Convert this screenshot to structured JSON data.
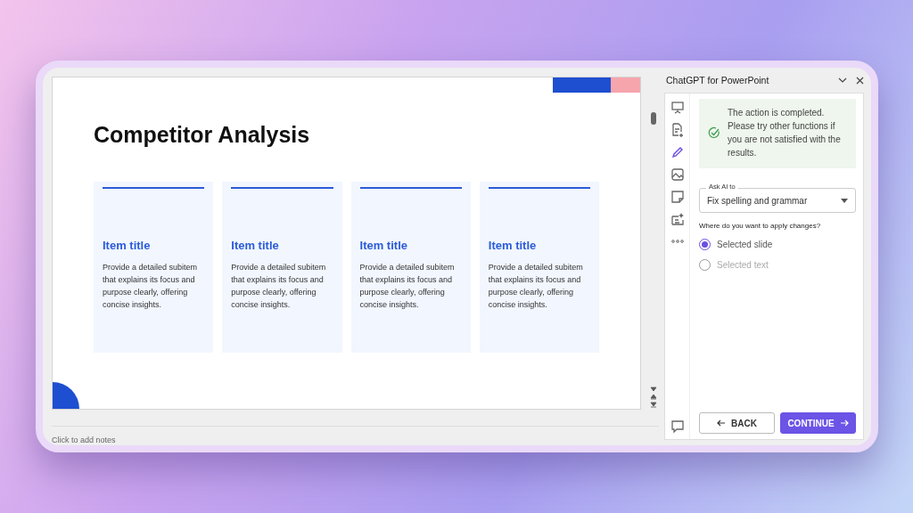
{
  "slide": {
    "title": "Competitor Analysis",
    "cards": [
      {
        "title": "Item title",
        "body": "Provide a detailed subitem that explains its focus and purpose clearly, offering concise insights."
      },
      {
        "title": "Item title",
        "body": "Provide a detailed subitem that explains its focus and purpose clearly, offering concise insights."
      },
      {
        "title": "Item title",
        "body": "Provide a detailed subitem that explains its focus and purpose clearly, offering concise insights."
      },
      {
        "title": "Item title",
        "body": "Provide a detailed subitem that explains its focus and purpose clearly, offering concise insights."
      }
    ]
  },
  "notes": {
    "placeholder": "Click to add notes"
  },
  "panel": {
    "title": "ChatGPT for PowerPoint",
    "tools": [
      {
        "kind": "slide",
        "selected": false
      },
      {
        "kind": "document",
        "selected": false
      },
      {
        "kind": "pencil",
        "selected": true
      },
      {
        "kind": "image",
        "selected": false
      },
      {
        "kind": "note",
        "selected": false
      },
      {
        "kind": "sparkle",
        "selected": false
      },
      {
        "kind": "more",
        "selected": false
      }
    ],
    "toast": "The action is completed. Please try other functions if you are not satisfied with the results.",
    "ask": {
      "label": "Ask AI to",
      "value": "Fix spelling and grammar"
    },
    "question": "Where do you want to apply changes?",
    "options": [
      {
        "label": "Selected slide",
        "selected": true,
        "disabled": false
      },
      {
        "label": "Selected text",
        "selected": false,
        "disabled": true
      }
    ],
    "back": "BACK",
    "continue": "CONTINUE"
  }
}
